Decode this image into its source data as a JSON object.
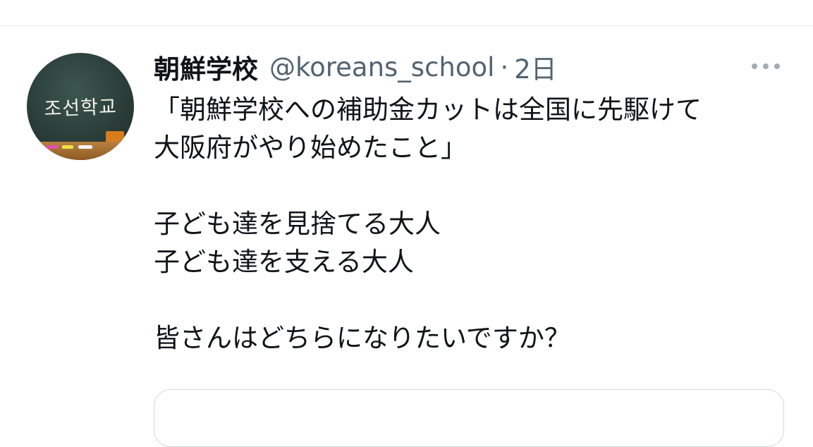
{
  "tweet": {
    "display_name": "朝鮮学校",
    "handle": "@koreans_school",
    "separator": "·",
    "timestamp": "2日",
    "more_icon": "ellipsis-icon",
    "avatar": {
      "chalkboard_text": "조선학교"
    },
    "body_lines": [
      "「朝鮮学校への補助金カットは全国に先駆けて",
      "大阪府がやり始めたこと」",
      "",
      "子ども達を見捨てる大人",
      "子ども達を支える大人",
      "",
      "皆さんはどちらになりたいですか？"
    ]
  },
  "colors": {
    "text_primary": "#0f1419",
    "text_secondary": "#536471",
    "divider": "#e3e6e9",
    "card_border": "#cfd9de",
    "chalkboard": "#2b3d39",
    "chalk_ledge": "#b8813f"
  }
}
